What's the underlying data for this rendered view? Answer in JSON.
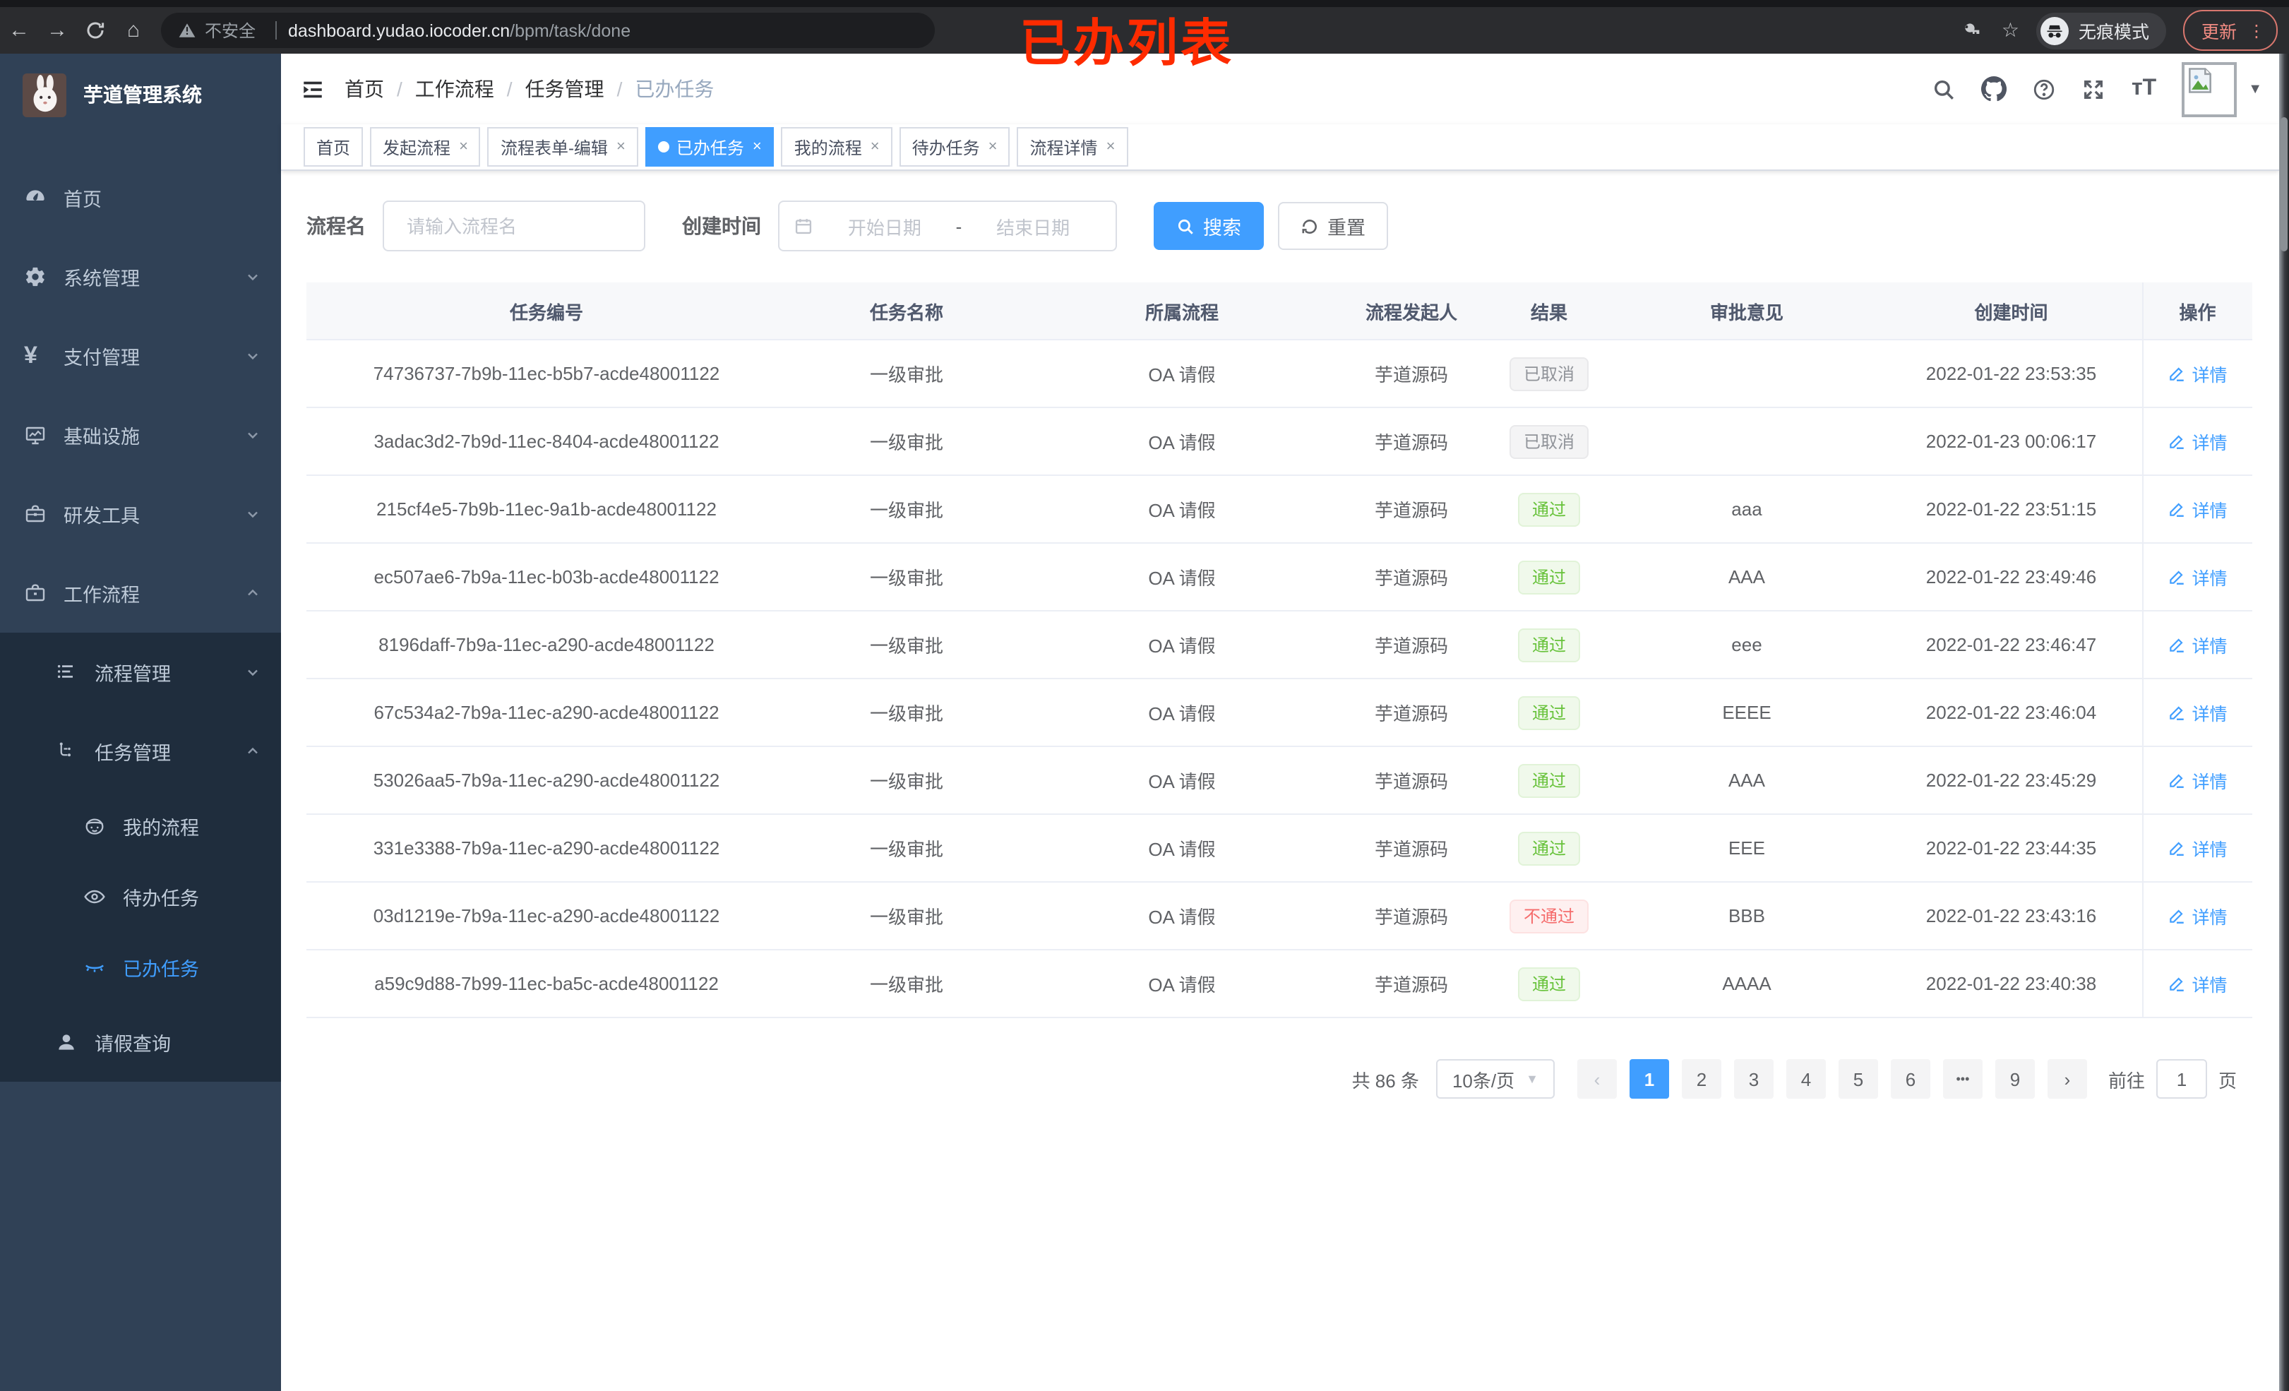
{
  "colors": {
    "accent": "#409eff",
    "success": "#67c23a",
    "danger": "#f56c6c",
    "info": "#909399",
    "annotation": "#fe2b00",
    "sidebar_bg": "#304156",
    "submenu_bg": "#1f2d3d"
  },
  "annotation": {
    "text": "已办列表"
  },
  "browser": {
    "security_label": "不安全",
    "url_host": "dashboard.yudao.iocoder.cn",
    "url_path": "/bpm/task/done",
    "incognito_label": "无痕模式",
    "update_label": "更新",
    "kebab": "⋮",
    "back": "←",
    "forward": "→",
    "home": "⌂",
    "star": "☆"
  },
  "sidebar": {
    "title": "芋道管理系统",
    "menu": [
      {
        "label": "首页",
        "icon": "dashboard-icon",
        "level": 1,
        "section": "top"
      },
      {
        "label": "系统管理",
        "icon": "gear-icon",
        "level": 1,
        "arrow": "down",
        "section": "top"
      },
      {
        "label": "支付管理",
        "icon": "yen-icon",
        "level": 1,
        "arrow": "down",
        "section": "top"
      },
      {
        "label": "基础设施",
        "icon": "monitor-icon",
        "level": 1,
        "arrow": "down",
        "section": "top"
      },
      {
        "label": "研发工具",
        "icon": "toolbox-icon",
        "level": 1,
        "arrow": "down",
        "section": "top"
      },
      {
        "label": "工作流程",
        "icon": "briefcase-icon",
        "level": 1,
        "arrow": "up",
        "section": "top"
      },
      {
        "label": "流程管理",
        "icon": "list-icon",
        "level": 2,
        "arrow": "down",
        "section": "sub"
      },
      {
        "label": "任务管理",
        "icon": "flow-icon",
        "level": 2,
        "arrow": "up",
        "section": "sub"
      },
      {
        "label": "我的流程",
        "icon": "face-icon",
        "level": 3,
        "section": "sub"
      },
      {
        "label": "待办任务",
        "icon": "eye-open-icon",
        "level": 3,
        "section": "sub"
      },
      {
        "label": "已办任务",
        "icon": "eye-closed-icon",
        "level": 3,
        "section": "sub",
        "active": true
      },
      {
        "label": "请假查询",
        "icon": "user-icon",
        "level": 2,
        "section": "sub"
      }
    ]
  },
  "header": {
    "breadcrumb": [
      "首页",
      "工作流程",
      "任务管理",
      "已办任务"
    ],
    "right_icons": [
      "search-icon",
      "github-icon",
      "question-icon",
      "fullscreen-icon",
      "text-size-icon"
    ],
    "text_size_glyph": "тT"
  },
  "tabs": [
    {
      "label": "首页",
      "closable": false,
      "active": false
    },
    {
      "label": "发起流程",
      "closable": true,
      "active": false
    },
    {
      "label": "流程表单-编辑",
      "closable": true,
      "active": false
    },
    {
      "label": "已办任务",
      "closable": true,
      "active": true
    },
    {
      "label": "我的流程",
      "closable": true,
      "active": false
    },
    {
      "label": "待办任务",
      "closable": true,
      "active": false
    },
    {
      "label": "流程详情",
      "closable": true,
      "active": false
    }
  ],
  "filter": {
    "name_label": "流程名",
    "name_placeholder": "请输入流程名",
    "time_label": "创建时间",
    "start_placeholder": "开始日期",
    "range_separator": "-",
    "end_placeholder": "结束日期",
    "search_label": "搜索",
    "reset_label": "重置"
  },
  "table": {
    "columns": [
      "任务编号",
      "任务名称",
      "所属流程",
      "流程发起人",
      "结果",
      "审批意见",
      "创建时间",
      "操作"
    ],
    "detail_label": "详情",
    "rows": [
      {
        "id": "74736737-7b9b-11ec-b5b7-acde48001122",
        "name": "一级审批",
        "process": "OA 请假",
        "initiator": "芋道源码",
        "result": "已取消",
        "result_type": "info",
        "comment": "",
        "created": "2022-01-22 23:53:35"
      },
      {
        "id": "3adac3d2-7b9d-11ec-8404-acde48001122",
        "name": "一级审批",
        "process": "OA 请假",
        "initiator": "芋道源码",
        "result": "已取消",
        "result_type": "info",
        "comment": "",
        "created": "2022-01-23 00:06:17"
      },
      {
        "id": "215cf4e5-7b9b-11ec-9a1b-acde48001122",
        "name": "一级审批",
        "process": "OA 请假",
        "initiator": "芋道源码",
        "result": "通过",
        "result_type": "success",
        "comment": "aaa",
        "created": "2022-01-22 23:51:15"
      },
      {
        "id": "ec507ae6-7b9a-11ec-b03b-acde48001122",
        "name": "一级审批",
        "process": "OA 请假",
        "initiator": "芋道源码",
        "result": "通过",
        "result_type": "success",
        "comment": "AAA",
        "created": "2022-01-22 23:49:46"
      },
      {
        "id": "8196daff-7b9a-11ec-a290-acde48001122",
        "name": "一级审批",
        "process": "OA 请假",
        "initiator": "芋道源码",
        "result": "通过",
        "result_type": "success",
        "comment": "eee",
        "created": "2022-01-22 23:46:47"
      },
      {
        "id": "67c534a2-7b9a-11ec-a290-acde48001122",
        "name": "一级审批",
        "process": "OA 请假",
        "initiator": "芋道源码",
        "result": "通过",
        "result_type": "success",
        "comment": "EEEE",
        "created": "2022-01-22 23:46:04"
      },
      {
        "id": "53026aa5-7b9a-11ec-a290-acde48001122",
        "name": "一级审批",
        "process": "OA 请假",
        "initiator": "芋道源码",
        "result": "通过",
        "result_type": "success",
        "comment": "AAA",
        "created": "2022-01-22 23:45:29"
      },
      {
        "id": "331e3388-7b9a-11ec-a290-acde48001122",
        "name": "一级审批",
        "process": "OA 请假",
        "initiator": "芋道源码",
        "result": "通过",
        "result_type": "success",
        "comment": "EEE",
        "created": "2022-01-22 23:44:35"
      },
      {
        "id": "03d1219e-7b9a-11ec-a290-acde48001122",
        "name": "一级审批",
        "process": "OA 请假",
        "initiator": "芋道源码",
        "result": "不通过",
        "result_type": "danger",
        "comment": "BBB",
        "created": "2022-01-22 23:43:16"
      },
      {
        "id": "a59c9d88-7b99-11ec-ba5c-acde48001122",
        "name": "一级审批",
        "process": "OA 请假",
        "initiator": "芋道源码",
        "result": "通过",
        "result_type": "success",
        "comment": "AAAA",
        "created": "2022-01-22 23:40:38"
      }
    ]
  },
  "pagination": {
    "total_label": "共 86 条",
    "page_size_label": "10条/页",
    "pages": [
      "prev",
      "1",
      "2",
      "3",
      "4",
      "5",
      "6",
      "more",
      "9",
      "next"
    ],
    "active_page": "1",
    "goto_label": "前往",
    "goto_value": "1",
    "goto_unit": "页"
  }
}
